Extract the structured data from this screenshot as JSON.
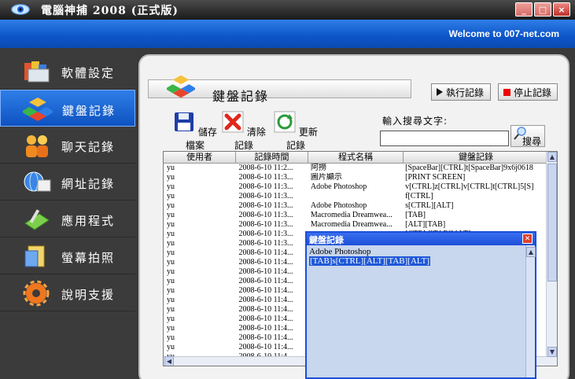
{
  "window": {
    "title": "電腦神捕 2008 (正式版)",
    "controls": [
      "_",
      "□",
      "×"
    ]
  },
  "banner": {
    "welcome": "Welcome to 007-net.com"
  },
  "sidebar": {
    "items": [
      {
        "label": "軟體設定",
        "icon": "software-settings-icon"
      },
      {
        "label": "鍵盤記錄",
        "icon": "keyboard-log-icon",
        "active": true
      },
      {
        "label": "聊天記錄",
        "icon": "chat-log-icon"
      },
      {
        "label": "網址記錄",
        "icon": "url-log-icon"
      },
      {
        "label": "應用程式",
        "icon": "applications-icon"
      },
      {
        "label": "螢幕拍照",
        "icon": "screenshot-icon"
      },
      {
        "label": "說明支援",
        "icon": "help-icon"
      }
    ]
  },
  "panel": {
    "title": "鍵盤記錄",
    "run_label": "執行記錄",
    "stop_label": "停止記錄",
    "toolbar": {
      "save": "儲存檔案",
      "clear": "清除記錄",
      "refresh": "更新記錄"
    },
    "search": {
      "label": "輸入搜尋文字:",
      "value": "",
      "button": "搜尋"
    }
  },
  "table": {
    "headers": [
      "使用者",
      "記錄時間",
      "程式名稱",
      "鍵盤記錄"
    ],
    "rows": [
      [
        "yu",
        "2008-6-10 11:2...",
        "阿撈",
        "[SpaceBar][CTRL]t[SpaceBar]9x6j0618"
      ],
      [
        "yu",
        "2008-6-10 11:3...",
        "圖片顯示",
        "[PRINT SCREEN]"
      ],
      [
        "yu",
        "2008-6-10 11:3...",
        "Adobe Photoshop",
        "v[CTRL]z[CTRL]v[CTRL]t[CTRL]5[S]"
      ],
      [
        "yu",
        "2008-6-10 11:3...",
        "",
        "f[CTRL]"
      ],
      [
        "yu",
        "2008-6-10 11:3...",
        "Adobe Photoshop",
        "s[CTRL][ALT]"
      ],
      [
        "yu",
        "2008-6-10 11:3...",
        "Macromedia Dreamwea...",
        "[TAB]"
      ],
      [
        "yu",
        "2008-6-10 11:3...",
        "Macromedia Dreamwea...",
        "[ALT][TAB]"
      ],
      [
        "yu",
        "2008-6-10 11:3...",
        "",
        "[CTRL][TAB][ALT]"
      ],
      [
        "yu",
        "2008-6-10 11:3...",
        "",
        ""
      ],
      [
        "yu",
        "2008-6-10 11:4...",
        "",
        ""
      ],
      [
        "yu",
        "2008-6-10 11:4...",
        "",
        ""
      ],
      [
        "yu",
        "2008-6-10 11:4...",
        "",
        ""
      ],
      [
        "yu",
        "2008-6-10 11:4...",
        "",
        ""
      ],
      [
        "yu",
        "2008-6-10 11:4...",
        "",
        ""
      ],
      [
        "yu",
        "2008-6-10 11:4...",
        "",
        ""
      ],
      [
        "yu",
        "2008-6-10 11:4...",
        "",
        ""
      ],
      [
        "yu",
        "2008-6-10 11:4...",
        "",
        ""
      ],
      [
        "yu",
        "2008-6-10 11:4...",
        "",
        ""
      ],
      [
        "yu",
        "2008-6-10 11:4...",
        "",
        ""
      ],
      [
        "yu",
        "2008-6-10 11:4...",
        "",
        ""
      ],
      [
        "yu",
        "2008-6-10 11:4...",
        "",
        ""
      ],
      [
        "yu",
        "2008-6-10 11:4",
        "",
        ""
      ]
    ]
  },
  "popup": {
    "title": "鍵盤記錄",
    "app": "Adobe Photoshop",
    "keys": "[TAB]s[CTRL][ALT][TAB][ALT]"
  },
  "colors": {
    "accent": "#0c55c8",
    "sidebar": "#3b3b3b",
    "stop": "#e00000"
  }
}
